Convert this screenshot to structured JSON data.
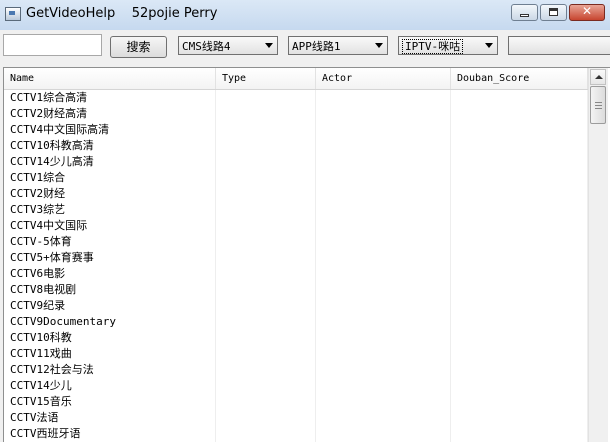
{
  "window": {
    "title": "GetVideoHelp    52pojie Perry"
  },
  "toolbar": {
    "search_value": "",
    "search_button": "搜索",
    "cms_line": "CMS线路4",
    "app_line": "APP线路1",
    "iptv_line": "IPTV-咪咕",
    "extra_select": ""
  },
  "table": {
    "columns": [
      "Name",
      "Type",
      "Actor",
      "Douban_Score"
    ],
    "rows": [
      {
        "name": "CCTV1综合高清",
        "type": "",
        "actor": "",
        "score": ""
      },
      {
        "name": "CCTV2财经高清",
        "type": "",
        "actor": "",
        "score": ""
      },
      {
        "name": "CCTV4中文国际高清",
        "type": "",
        "actor": "",
        "score": ""
      },
      {
        "name": "CCTV10科教高清",
        "type": "",
        "actor": "",
        "score": ""
      },
      {
        "name": "CCTV14少儿高清",
        "type": "",
        "actor": "",
        "score": ""
      },
      {
        "name": "CCTV1综合",
        "type": "",
        "actor": "",
        "score": ""
      },
      {
        "name": "CCTV2财经",
        "type": "",
        "actor": "",
        "score": ""
      },
      {
        "name": "CCTV3综艺",
        "type": "",
        "actor": "",
        "score": ""
      },
      {
        "name": "CCTV4中文国际",
        "type": "",
        "actor": "",
        "score": ""
      },
      {
        "name": "CCTV-5体育",
        "type": "",
        "actor": "",
        "score": ""
      },
      {
        "name": "CCTV5+体育赛事",
        "type": "",
        "actor": "",
        "score": ""
      },
      {
        "name": "CCTV6电影",
        "type": "",
        "actor": "",
        "score": ""
      },
      {
        "name": "CCTV8电视剧",
        "type": "",
        "actor": "",
        "score": ""
      },
      {
        "name": "CCTV9纪录",
        "type": "",
        "actor": "",
        "score": ""
      },
      {
        "name": "CCTV9Documentary",
        "type": "",
        "actor": "",
        "score": ""
      },
      {
        "name": "CCTV10科教",
        "type": "",
        "actor": "",
        "score": ""
      },
      {
        "name": "CCTV11戏曲",
        "type": "",
        "actor": "",
        "score": ""
      },
      {
        "name": "CCTV12社会与法",
        "type": "",
        "actor": "",
        "score": ""
      },
      {
        "name": "CCTV14少儿",
        "type": "",
        "actor": "",
        "score": ""
      },
      {
        "name": "CCTV15音乐",
        "type": "",
        "actor": "",
        "score": ""
      },
      {
        "name": "CCTV法语",
        "type": "",
        "actor": "",
        "score": ""
      },
      {
        "name": "CCTV西班牙语",
        "type": "",
        "actor": "",
        "score": ""
      }
    ]
  },
  "icons": {
    "app": "app-window-icon",
    "minimize": "minimize-icon",
    "maximize": "maximize-icon",
    "close": "close-icon",
    "dropdown": "chevron-down-icon",
    "scroll_up": "scroll-up-arrow-icon"
  }
}
